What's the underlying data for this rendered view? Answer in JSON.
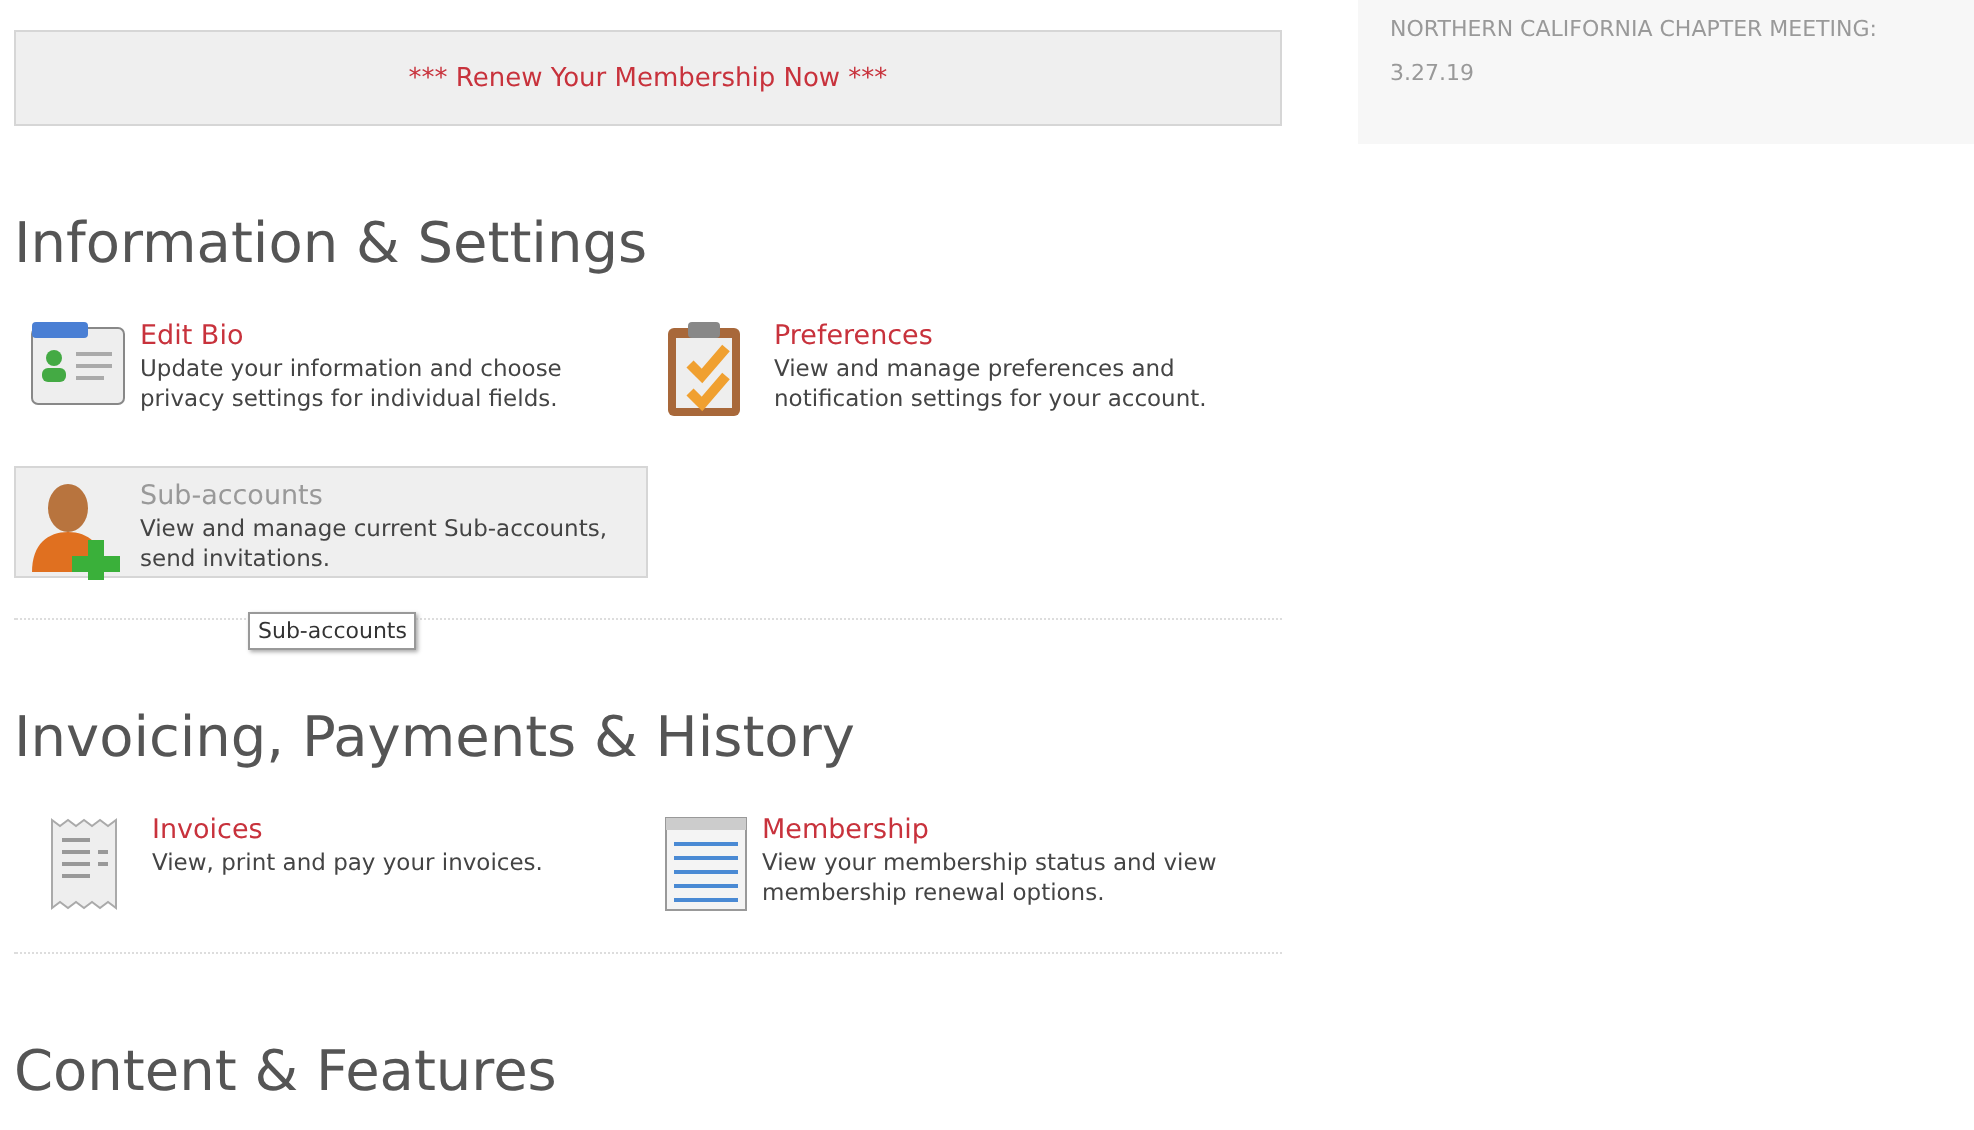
{
  "banner": {
    "text": "*** Renew Your Membership Now ***"
  },
  "sidebar": {
    "text": "NORTHERN CALIFORNIA CHAPTER MEETING: 3.27.19"
  },
  "sections": [
    {
      "title": "Information & Settings",
      "items": [
        {
          "kind": "id-card",
          "title": "Edit Bio",
          "description": "Update your information and choose privacy settings for individual fields.",
          "hovered": false
        },
        {
          "kind": "clipboard",
          "title": "Preferences",
          "description": "View and manage preferences and notification settings for your account.",
          "hovered": false
        },
        {
          "kind": "person-add",
          "title": "Sub-accounts",
          "description": "View and manage current Sub-accounts, send invitations.",
          "hovered": true,
          "tooltip": "Sub-accounts"
        }
      ]
    },
    {
      "title": "Invoicing, Payments & History",
      "items": [
        {
          "kind": "receipt",
          "title": "Invoices",
          "description": "View, print and pay your invoices.",
          "hovered": false
        },
        {
          "kind": "table",
          "title": "Membership",
          "description": "View your membership status and view membership renewal options.",
          "hovered": false
        }
      ]
    },
    {
      "title": "Content & Features"
    }
  ]
}
